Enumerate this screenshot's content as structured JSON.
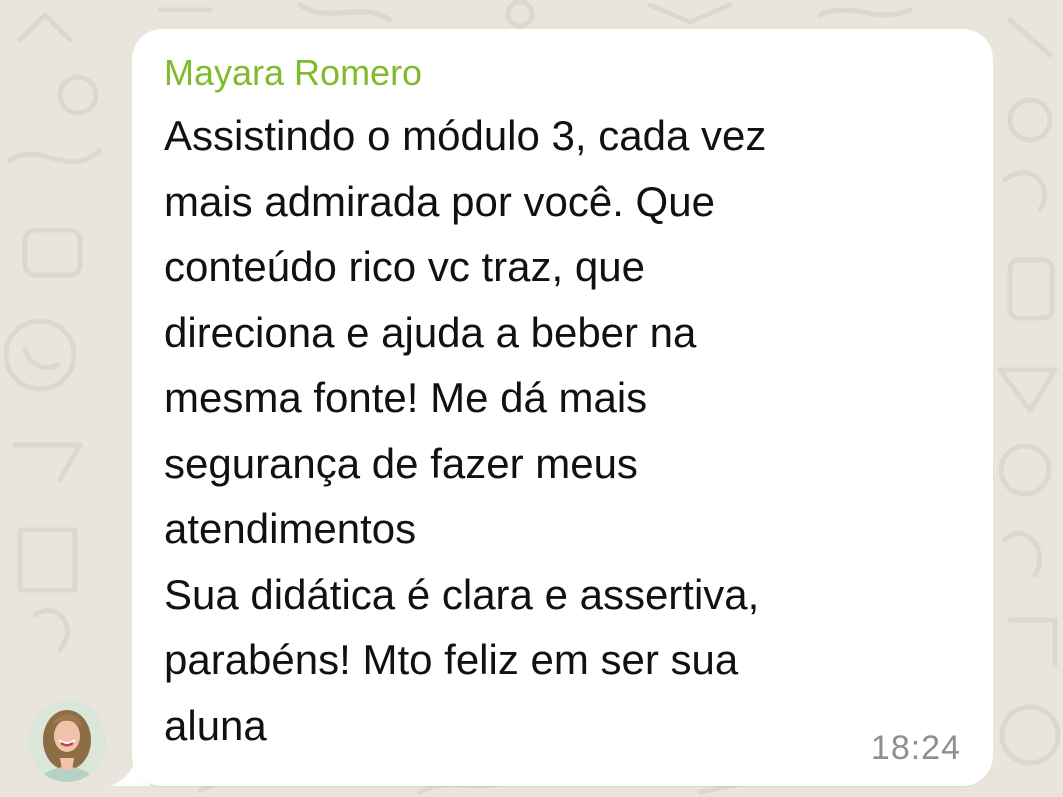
{
  "chat": {
    "sender_name": "Mayara Romero",
    "message_lines": [
      "Assistindo o módulo 3, cada vez",
      "mais admirada por você. Que",
      "conteúdo rico vc traz, que",
      "direciona e ajuda a beber na",
      "mesma fonte! Me dá mais",
      "segurança de fazer meus",
      "atendimentos",
      "Sua didática é clara e assertiva,",
      "parabéns! Mto feliz em ser sua",
      "aluna"
    ],
    "timestamp": "18:24"
  },
  "colors": {
    "background": "#e9e5dd",
    "bubble": "#ffffff",
    "sender_name": "#7fbb2c",
    "message_text": "#111111",
    "timestamp": "#8f8f8f"
  },
  "icons": {
    "avatar": "sender-avatar-photo"
  }
}
